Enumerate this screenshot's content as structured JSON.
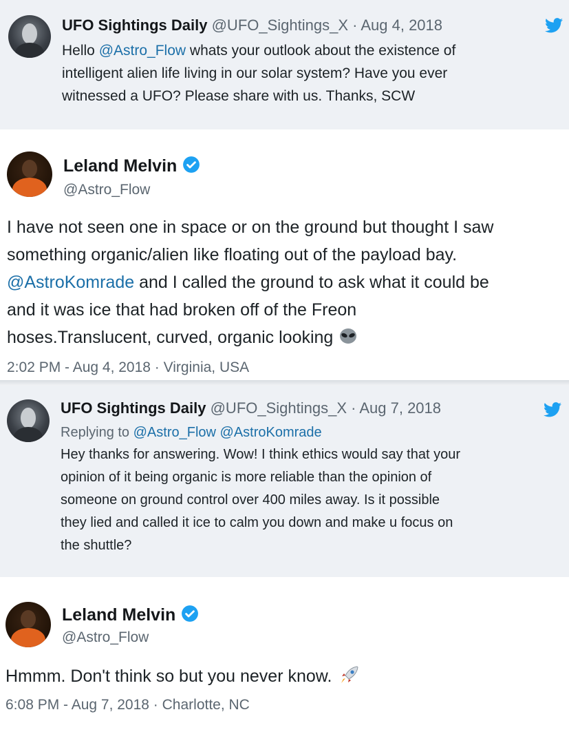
{
  "tweet1": {
    "name": "UFO Sightings Daily",
    "handle": "@UFO_Sightings_X",
    "sep": " · ",
    "date": "Aug 4, 2018",
    "line1_pre": "Hello ",
    "line1_mention": "@Astro_Flow",
    "line1_post": " whats your outlook about the existence of",
    "line2": "intelligent alien life living in our solar system? Have you ever",
    "line3": "witnessed a UFO? Please share with us. Thanks, SCW"
  },
  "reply1": {
    "name": "Leland Melvin",
    "handle": "@Astro_Flow",
    "line1": "I have not seen one in space or on the ground but thought I saw",
    "line2": "something organic/alien like floating out of the payload bay.",
    "line3_mention": "@AstroKomrade",
    "line3_post": " and I called the ground to ask what it could be",
    "line4": "and it was ice that had broken off of the Freon",
    "line5": "hoses.Translucent, curved, organic looking",
    "emoji": "alien-emoji",
    "meta": "2:02 PM - Aug 4, 2018 · Virginia, USA"
  },
  "tweet2": {
    "name": "UFO Sightings Daily",
    "handle": "@UFO_Sightings_X",
    "sep": " · ",
    "date": "Aug 7, 2018",
    "replying_label": "Replying to ",
    "replying_mentions": "@Astro_Flow @AstroKomrade",
    "line1": "Hey thanks for answering. Wow! I think ethics would say that your",
    "line2": "opinion of it being organic is more reliable than the opinion of",
    "line3": "someone on ground control over 400 miles away. Is it possible",
    "line4": "they lied and called it ice to calm you down and make u focus on",
    "line5": "the shuttle?"
  },
  "reply2": {
    "name": "Leland Melvin",
    "handle": "@Astro_Flow",
    "text": "Hmmm. Don't think so but you never know.",
    "emoji": "rocket-emoji",
    "meta": "6:08 PM - Aug 7, 2018 · Charlotte, NC"
  },
  "colors": {
    "twitter_blue": "#1da1f2",
    "mention": "#1b6fa8",
    "gray_bg": "#eef1f5"
  }
}
